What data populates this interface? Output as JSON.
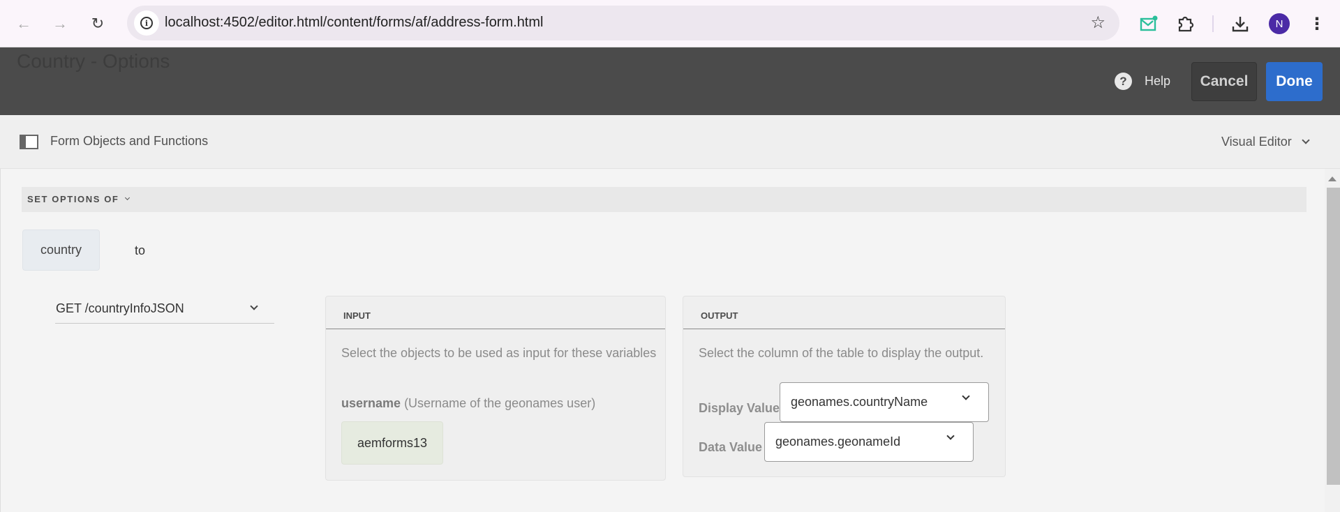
{
  "browser": {
    "url": "localhost:4502/editor.html/content/forms/af/address-form.html",
    "profile_initial": "N",
    "icons": [
      "back-icon",
      "forward-icon",
      "reload-icon",
      "site-info-icon",
      "bookmark-star-icon",
      "mail-extension-icon",
      "extensions-puzzle-icon",
      "download-icon",
      "menu-kebab-icon"
    ]
  },
  "header": {
    "title": "Country - Options",
    "help_label": "Help",
    "help_icon": "?",
    "cancel_label": "Cancel",
    "done_label": "Done",
    "done_color": "#2d6dcc"
  },
  "toolbar": {
    "panel_label": "Form Objects and Functions",
    "mode_selected": "Visual Editor"
  },
  "rule": {
    "statement": "SET OPTIONS OF",
    "target_field": "country",
    "connector": "to",
    "service": "GET /countryInfoJSON",
    "input": {
      "heading": "INPUT",
      "description": "Select the objects to be used as input for these variables",
      "variable_name": "username",
      "variable_desc": "(Username of the geonames user)",
      "variable_value": "aemforms13"
    },
    "output": {
      "heading": "OUTPUT",
      "description": "Select the column of the table to display the output.",
      "display_value_label": "Display Value",
      "display_value": "geonames.countryName",
      "data_value_label": "Data Value",
      "data_value": "geonames.geonameId"
    }
  }
}
